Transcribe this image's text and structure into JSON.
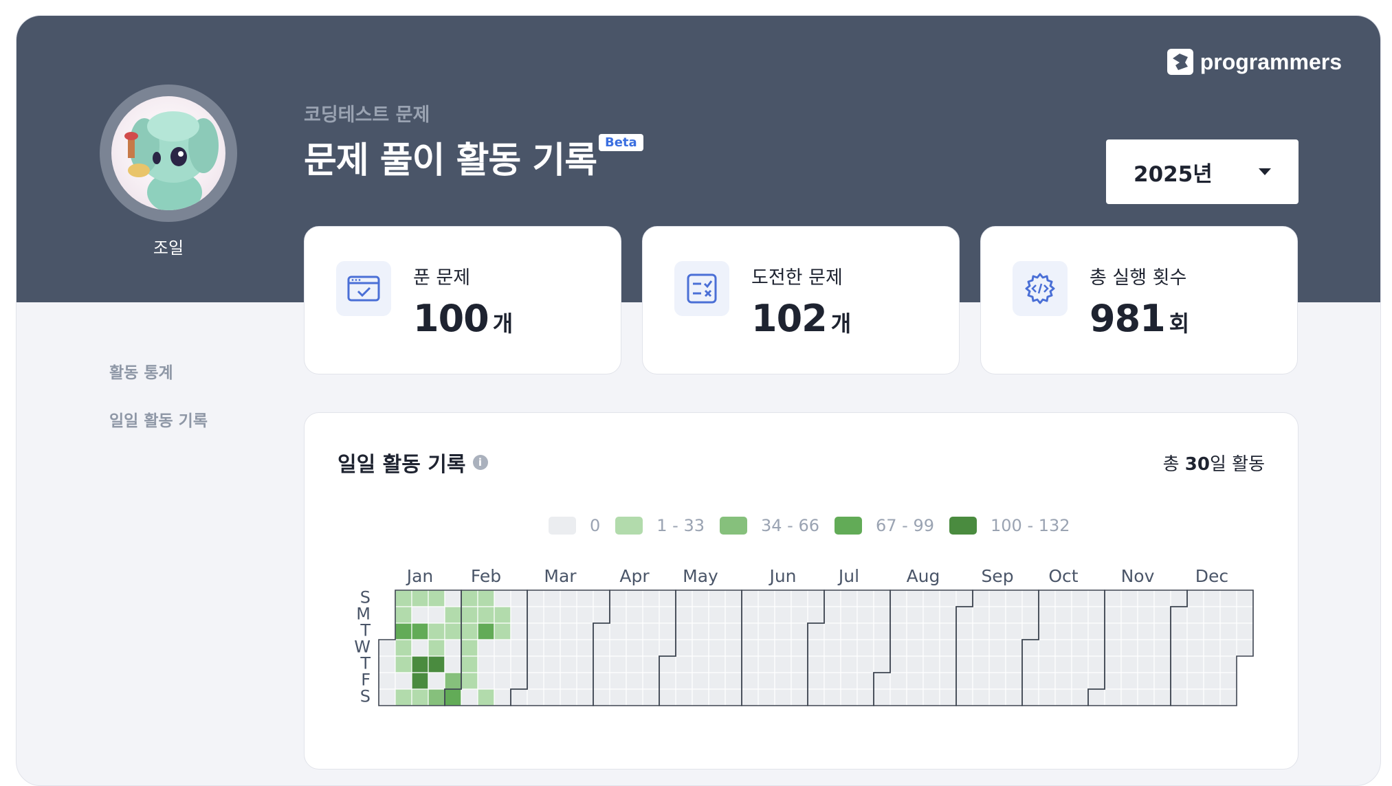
{
  "brand": {
    "name": "programmers"
  },
  "profile": {
    "username": "조일"
  },
  "header": {
    "subtitle": "코딩테스트 문제",
    "title": "문제 풀이 활동 기록",
    "badge": "Beta"
  },
  "year_select": {
    "value": "2025년"
  },
  "stats": [
    {
      "label": "푼 문제",
      "value": "100",
      "unit": "개",
      "icon": "solved-icon"
    },
    {
      "label": "도전한 문제",
      "value": "102",
      "unit": "개",
      "icon": "challenged-icon"
    },
    {
      "label": "총 실행 횟수",
      "value": "981",
      "unit": "회",
      "icon": "code-gear-icon"
    }
  ],
  "side_nav": {
    "items": [
      "활동 통계",
      "일일 활동 기록"
    ]
  },
  "activity": {
    "title": "일일 활동 기록",
    "total_prefix": "총 ",
    "total_days": "30",
    "total_suffix": "일 활동",
    "legend": [
      {
        "label": "0",
        "color": "#ebedf0"
      },
      {
        "label": "1 - 33",
        "color": "#b2dbac"
      },
      {
        "label": "34 - 66",
        "color": "#86c07c"
      },
      {
        "label": "67 - 99",
        "color": "#62ab57"
      },
      {
        "label": "100 - 132",
        "color": "#4a8b3f"
      }
    ],
    "months": [
      "Jan",
      "Feb",
      "Mar",
      "Apr",
      "May",
      "Jun",
      "Jul",
      "Aug",
      "Sep",
      "Oct",
      "Nov",
      "Dec"
    ],
    "weekdays": [
      "S",
      "M",
      "T",
      "W",
      "T",
      "F",
      "S"
    ],
    "year": 2025,
    "active_days": [
      {
        "date": "2025-01-05",
        "level": 1
      },
      {
        "date": "2025-01-06",
        "level": 1
      },
      {
        "date": "2025-01-07",
        "level": 3
      },
      {
        "date": "2025-01-08",
        "level": 1
      },
      {
        "date": "2025-01-09",
        "level": 1
      },
      {
        "date": "2025-01-11",
        "level": 1
      },
      {
        "date": "2025-01-12",
        "level": 1
      },
      {
        "date": "2025-01-14",
        "level": 3
      },
      {
        "date": "2025-01-16",
        "level": 4
      },
      {
        "date": "2025-01-17",
        "level": 4
      },
      {
        "date": "2025-01-18",
        "level": 1
      },
      {
        "date": "2025-01-19",
        "level": 1
      },
      {
        "date": "2025-01-21",
        "level": 1
      },
      {
        "date": "2025-01-22",
        "level": 1
      },
      {
        "date": "2025-01-23",
        "level": 4
      },
      {
        "date": "2025-01-25",
        "level": 2
      },
      {
        "date": "2025-01-27",
        "level": 1
      },
      {
        "date": "2025-01-28",
        "level": 1
      },
      {
        "date": "2025-01-31",
        "level": 2
      },
      {
        "date": "2025-02-01",
        "level": 3
      },
      {
        "date": "2025-02-02",
        "level": 1
      },
      {
        "date": "2025-02-03",
        "level": 1
      },
      {
        "date": "2025-02-04",
        "level": 1
      },
      {
        "date": "2025-02-05",
        "level": 1
      },
      {
        "date": "2025-02-06",
        "level": 1
      },
      {
        "date": "2025-02-07",
        "level": 1
      },
      {
        "date": "2025-02-09",
        "level": 1
      },
      {
        "date": "2025-02-10",
        "level": 1
      },
      {
        "date": "2025-02-11",
        "level": 3
      },
      {
        "date": "2025-02-15",
        "level": 1
      },
      {
        "date": "2025-02-17",
        "level": 1
      },
      {
        "date": "2025-02-18",
        "level": 1
      }
    ]
  }
}
